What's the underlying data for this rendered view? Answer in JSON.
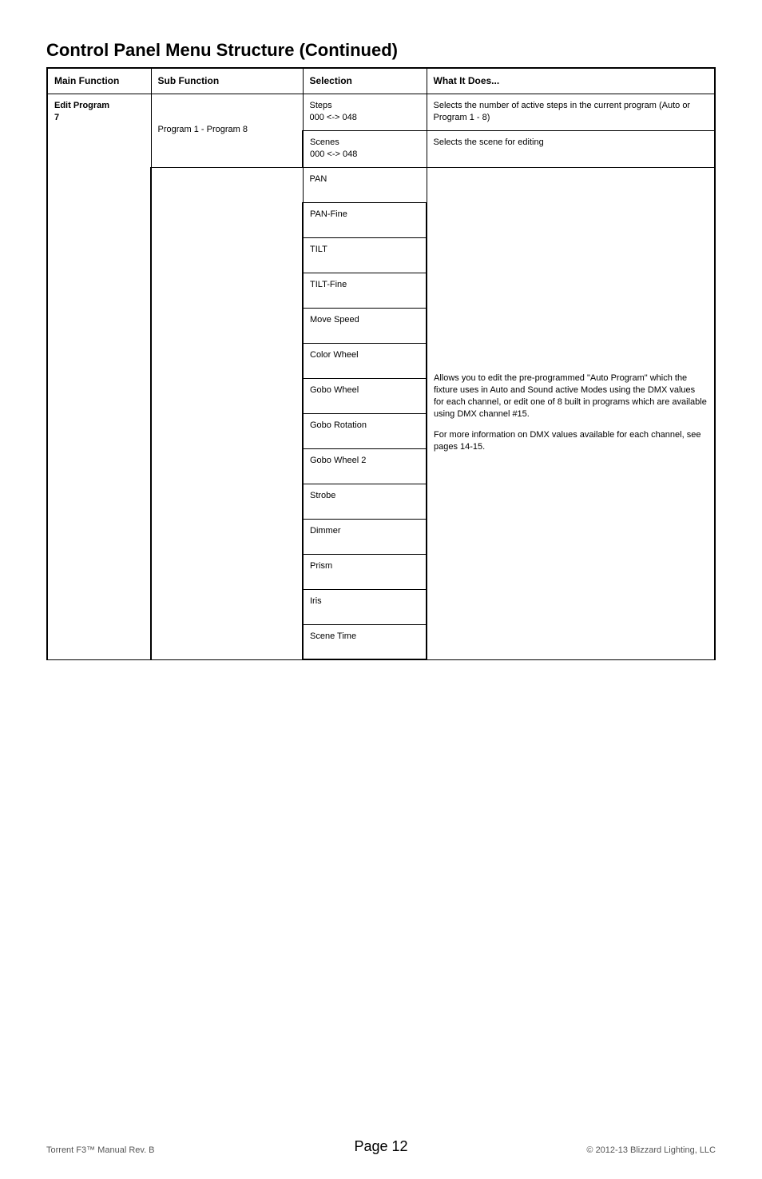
{
  "title": "Control Panel Menu Structure (Continued)",
  "headers": {
    "main_function": "Main Function",
    "sub_function": "Sub Function",
    "selection": "Selection",
    "what_it_does": "What It Does..."
  },
  "main_function": {
    "label": "Edit Program",
    "number": "7"
  },
  "sub_function": "Program 1 - Program 8",
  "rows": [
    {
      "selection_line1": "Steps",
      "selection_line2": "000 <-> 048",
      "desc": "Selects the number of active steps in the current program (Auto or Program 1 - 8)"
    },
    {
      "selection_line1": "Scenes",
      "selection_line2": "000 <-> 048",
      "desc": "Selects the scene for editing"
    }
  ],
  "selections": [
    "PAN",
    "PAN-Fine",
    "TILT",
    "TILT-Fine",
    "Move Speed",
    "Color Wheel",
    "Gobo Wheel",
    "Gobo Rotation",
    "Gobo Wheel 2",
    "Strobe",
    "Dimmer",
    "Prism",
    "Iris",
    "Scene Time"
  ],
  "big_desc_p1": "Allows you to edit the pre-programmed \"Auto Program\" which the fixture uses in Auto and Sound active Modes using the DMX values for each channel, or edit one of 8 built in programs which are available using DMX channel #15.",
  "big_desc_p2": "For more information on DMX values available for each channel, see pages 14-15.",
  "footer": {
    "left": "Torrent F3™ Manual Rev. B",
    "center": "Page 12",
    "right": "© 2012-13 Blizzard Lighting, LLC"
  }
}
